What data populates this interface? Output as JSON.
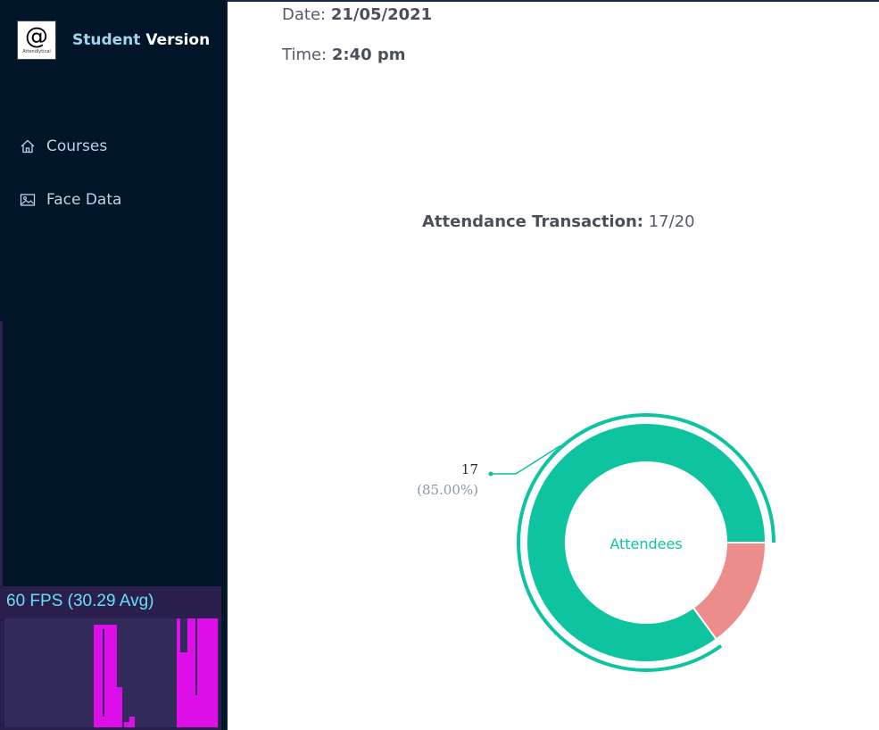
{
  "sidebar": {
    "brand": {
      "logo_glyph": "@",
      "logo_text": "Attendlytical",
      "name_accent": "Student",
      "name_rest": "Version"
    },
    "items": [
      {
        "label": "Courses",
        "icon": "home-icon"
      },
      {
        "label": "Face Data",
        "icon": "image-icon"
      }
    ]
  },
  "header": {
    "date_label": "Date:",
    "date_value": "21/05/2021",
    "time_label": "Time:",
    "time_value": "2:40 pm"
  },
  "transaction": {
    "label": "Attendance Transaction:",
    "value": "17/20"
  },
  "fps_meter": {
    "text": "60 FPS (30.29 Avg)"
  },
  "chart_data": {
    "type": "pie",
    "hole": true,
    "center_label": "Attendees",
    "slices": [
      {
        "label": "Attendees",
        "value": 17,
        "percent": "85.00%",
        "color": "#0ec4a0",
        "label_shown": true
      },
      {
        "label": "",
        "value": 3,
        "percent": "15.00%",
        "color": "#ec8d8c",
        "label_shown": false
      }
    ],
    "outer_label_value": "17",
    "outer_label_percent": "(85.00%)",
    "colors": {
      "attendees": "#0ec4a0",
      "absentees": "#ec8d8c"
    }
  }
}
